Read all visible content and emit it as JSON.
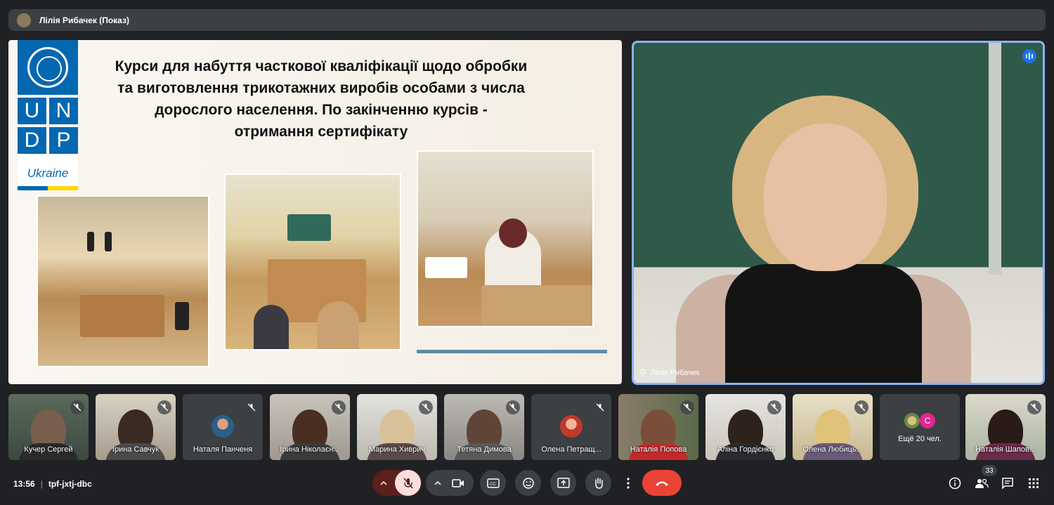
{
  "presenter": {
    "name": "Лілія Рибачек (Показ)"
  },
  "slide": {
    "logo_cells": [
      "U",
      "N",
      "D",
      "P"
    ],
    "logo_country": "Ukraine",
    "title": "Курси для набуття часткової кваліфікації щодо обробки та виготовлення трикотажних виробів особами з числа дорослого населення. По закінченню курсів  - отримання сертифікату"
  },
  "speaker": {
    "name": "Лілія Рибачек"
  },
  "participants": [
    {
      "name": "Кучер Сергей",
      "muted": true
    },
    {
      "name": "Ірина Савчук",
      "muted": true
    },
    {
      "name": "Наталя Панченя",
      "muted": true
    },
    {
      "name": "Ірина Ніколаєн...",
      "muted": true
    },
    {
      "name": "Марина Хиврич",
      "muted": true
    },
    {
      "name": "Тетяна Димова",
      "muted": true
    },
    {
      "name": "Олена Петращ...",
      "muted": true
    },
    {
      "name": "Наталія Попова",
      "muted": true
    },
    {
      "name": "Аліна Гордієнко",
      "muted": true
    },
    {
      "name": "Олена Любиць...",
      "muted": true
    },
    {
      "more_label": "Ещё 20 чел.",
      "avatar_letter": "С"
    },
    {
      "name": "Наталія Шапов...",
      "muted": true
    }
  ],
  "bottom_bar": {
    "time": "13:56",
    "meeting_code": "tpf-jxtj-dbc",
    "participant_count": "33"
  },
  "icons": [
    "mic-off-icon",
    "chevron-up-icon",
    "camera-icon",
    "captions-icon",
    "emoji-icon",
    "present-icon",
    "raise-hand-icon",
    "more-options-icon",
    "end-call-icon",
    "info-icon",
    "people-icon",
    "chat-icon",
    "activities-icon",
    "speaking-icon"
  ],
  "colors": {
    "background": "#202124",
    "control": "#3c4043",
    "end_call": "#ea4335",
    "active_border": "#8ab4f8",
    "undp_blue": "#0468b1"
  }
}
